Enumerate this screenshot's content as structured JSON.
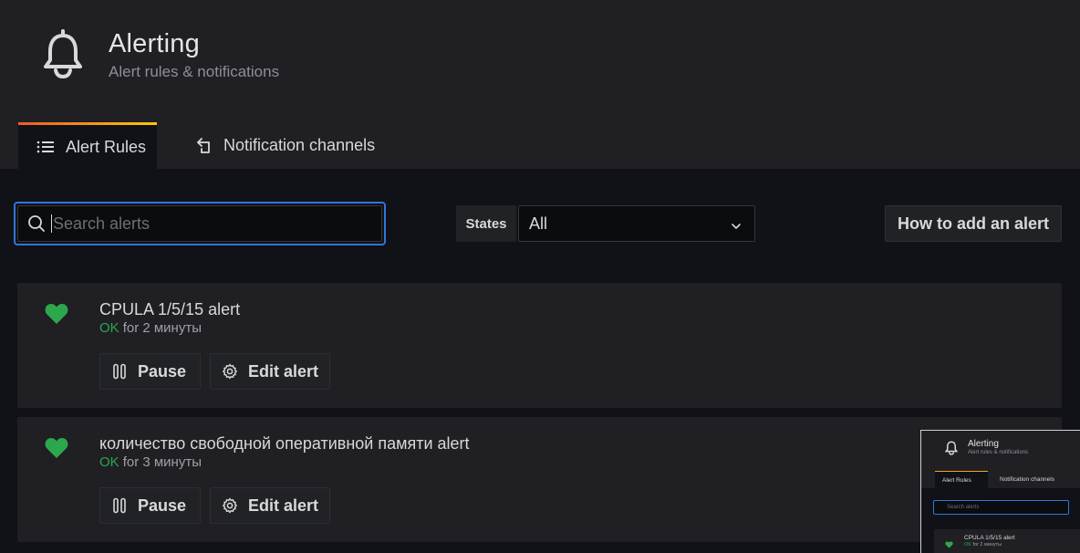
{
  "header": {
    "title": "Alerting",
    "subtitle": "Alert rules & notifications",
    "icon": "bell-icon"
  },
  "tabs": [
    {
      "label": "Alert Rules",
      "icon": "list-icon",
      "active": true
    },
    {
      "label": "Notification channels",
      "icon": "channel-arrow-icon",
      "active": false
    }
  ],
  "toolbar": {
    "search_placeholder": "Search alerts",
    "search_value": "",
    "states_label": "States",
    "states_value": "All",
    "how_to_label": "How to add an alert"
  },
  "alerts": [
    {
      "name": "CPULA 1/5/15 alert",
      "state": "OK",
      "duration": "for 2 минуты",
      "pause_label": "Pause",
      "edit_label": "Edit alert"
    },
    {
      "name": "количество свободной оперативной памяти alert",
      "state": "OK",
      "duration": "for 3 минуты",
      "pause_label": "Pause",
      "edit_label": "Edit alert"
    }
  ],
  "thumbnail": {
    "title": "Alerting",
    "subtitle": "Alert rules & notifications",
    "tab_active": "Alert Rules",
    "tab_other": "Notification channels",
    "search_placeholder": "Search alerts",
    "alert_name": "CPULA 1/5/15 alert",
    "alert_state": "OK",
    "alert_duration": "for 2 минуты"
  },
  "colors": {
    "ok_green": "#2da74c",
    "focus_blue": "#3274d9",
    "tab_gradient_start": "#f05a28",
    "tab_gradient_end": "#fbca0a"
  }
}
